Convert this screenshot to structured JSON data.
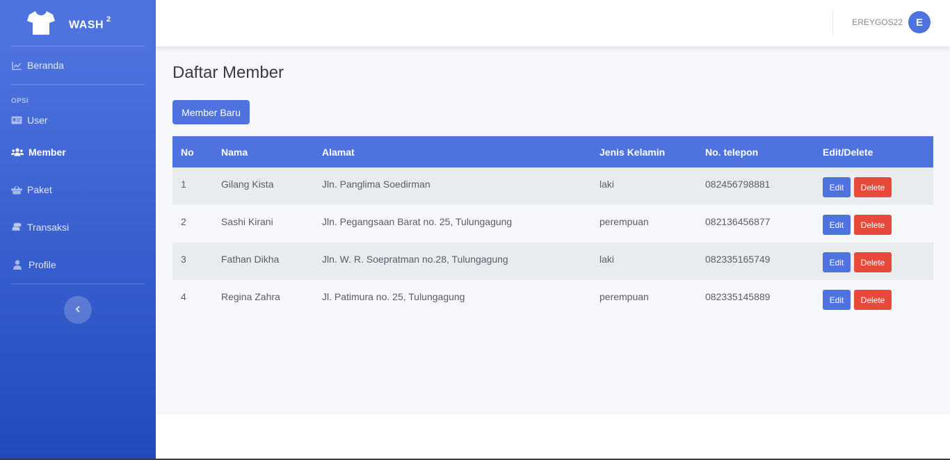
{
  "brand": {
    "name": "WASH",
    "superscript": "2",
    "icon": "tshirt-icon"
  },
  "sidebar": {
    "dashboard": {
      "label": "Beranda",
      "icon": "chart-line-icon"
    },
    "heading": "OPSI",
    "items": [
      {
        "label": "User",
        "icon": "id-card-icon",
        "active": false
      },
      {
        "label": "Member",
        "icon": "users-icon",
        "active": true
      },
      {
        "label": "Paket",
        "icon": "basket-icon",
        "active": false
      },
      {
        "label": "Transaksi",
        "icon": "coins-icon",
        "active": false
      },
      {
        "label": "Profile",
        "icon": "user-icon",
        "active": false
      }
    ],
    "toggle_icon": "chevron-left-icon"
  },
  "topbar": {
    "username": "EREYGOS22",
    "avatar_letter": "E"
  },
  "page": {
    "title": "Daftar Member",
    "add_button": "Member Baru"
  },
  "table": {
    "headers": [
      "No",
      "Nama",
      "Alamat",
      "Jenis Kelamin",
      "No. telepon",
      "Edit/Delete"
    ],
    "rows": [
      {
        "no": "1",
        "nama": "Gilang Kista",
        "alamat": "Jln. Panglima Soedirman",
        "jk": "laki",
        "telp": "082456798881"
      },
      {
        "no": "2",
        "nama": "Sashi Kirani",
        "alamat": "Jln. Pegangsaan Barat no. 25, Tulungagung",
        "jk": "perempuan",
        "telp": "082136456877"
      },
      {
        "no": "3",
        "nama": "Fathan Dikha",
        "alamat": "Jln. W. R. Soepratman no.28, Tulungagung",
        "jk": "laki",
        "telp": "082335165749"
      },
      {
        "no": "4",
        "nama": "Regina Zahra",
        "alamat": "Jl. Patimura no. 25, Tulungagung",
        "jk": "perempuan",
        "telp": "082335145889"
      }
    ],
    "edit_label": "Edit",
    "delete_label": "Delete"
  },
  "colors": {
    "primary": "#4e73df",
    "danger": "#e74a3b",
    "row_alt": "#e9ecef"
  }
}
